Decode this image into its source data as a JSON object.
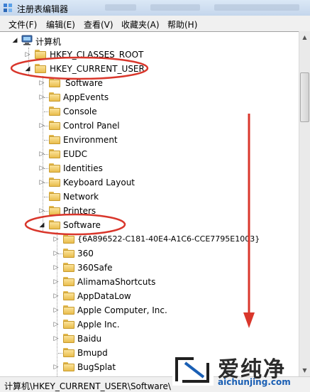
{
  "window": {
    "title": "注册表编辑器",
    "icon": "registry-editor-icon"
  },
  "menu": [
    "文件(F)",
    "编辑(E)",
    "查看(V)",
    "收藏夹(A)",
    "帮助(H)"
  ],
  "tree": {
    "root": "计算机",
    "hkey_classes_root": "HKEY_CLASSES_ROOT",
    "hkey_current_user": "HKEY_CURRENT_USER",
    "hkcu_children": [
      "Software",
      "AppEvents",
      "Console",
      "Control Panel",
      "Environment",
      "EUDC",
      "Identities",
      "Keyboard Layout",
      "Network",
      "Printers"
    ],
    "software": "Software",
    "software_children": [
      "{6A896522-C181-40E4-A1C6-CCE7795E1003}",
      "360",
      "360Safe",
      "AlimamaShortcuts",
      "AppDataLow",
      "Apple Computer, Inc.",
      "Apple Inc.",
      "Baidu",
      "Bmupd",
      "BugSplat"
    ]
  },
  "status": {
    "path": "计算机\\HKEY_CURRENT_USER\\Software\\"
  },
  "annotation": {
    "color": "#d9362b"
  },
  "watermark": {
    "chinese": "爱纯净",
    "url": "aichunjing.com"
  }
}
